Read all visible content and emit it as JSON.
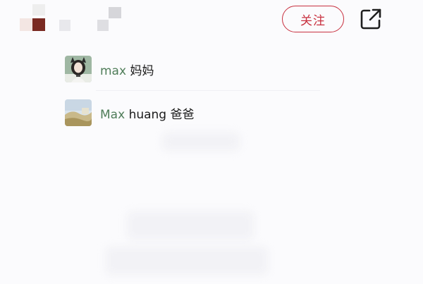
{
  "header": {
    "follow_label": "关注",
    "share_icon": "share-external-icon"
  },
  "likes": [
    {
      "nickname": "max",
      "remark": "妈妈",
      "avatar": "portrait-woman-avatar"
    },
    {
      "nickname": "Max",
      "remark": "huang 爸爸",
      "avatar": "landscape-avatar"
    }
  ],
  "colors": {
    "accent": "#c8303f",
    "nickname": "#4f7d59"
  }
}
